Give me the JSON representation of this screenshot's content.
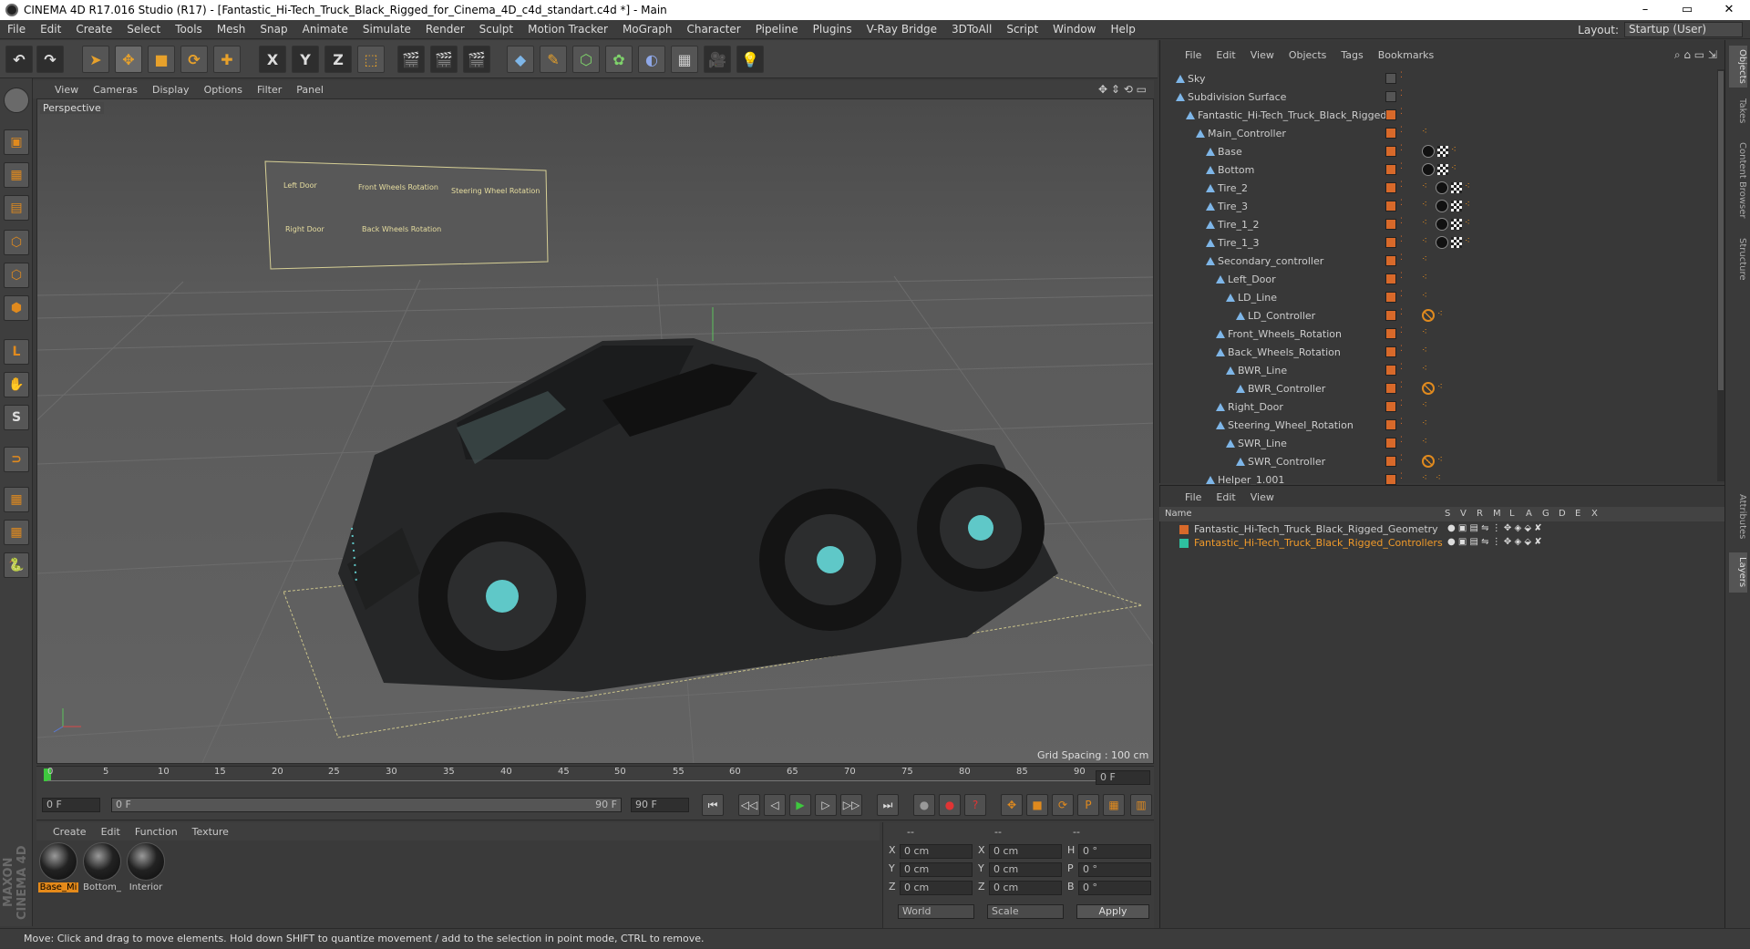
{
  "window": {
    "title": "CINEMA 4D R17.016 Studio (R17) - [Fantastic_Hi-Tech_Truck_Black_Rigged_for_Cinema_4D_c4d_standart.c4d *] - Main",
    "buttons": [
      "–",
      "▭",
      "✕"
    ]
  },
  "menu": [
    "File",
    "Edit",
    "Create",
    "Select",
    "Tools",
    "Mesh",
    "Snap",
    "Animate",
    "Simulate",
    "Render",
    "Sculpt",
    "Motion Tracker",
    "MoGraph",
    "Character",
    "Pipeline",
    "Plugins",
    "V-Ray Bridge",
    "3DToAll",
    "Script",
    "Window",
    "Help"
  ],
  "layout": {
    "label": "Layout:",
    "value": "Startup (User)"
  },
  "toolbar": [
    "↶",
    "↷",
    "➤",
    "✥",
    "■",
    "⟳",
    "✚",
    "X",
    "Y",
    "Z",
    "⬚",
    "🎬",
    "🎬",
    "🎬",
    "◆",
    "✎",
    "⬡",
    "✿",
    "◐",
    "▦",
    "🎥",
    "💡"
  ],
  "viewport": {
    "menu": [
      "View",
      "Cameras",
      "Display",
      "Options",
      "Filter",
      "Panel"
    ],
    "label": "Perspective",
    "grid_spacing": "Grid Spacing : 100 cm",
    "controls": {
      "left_door": "Left Door",
      "front_wheels": "Front Wheels Rotation",
      "steering_wheel": "Steering Wheel Rotation",
      "right_door": "Right Door",
      "back_wheels": "Back Wheels Rotation"
    }
  },
  "timeline": {
    "ticks": [
      "0",
      "5",
      "10",
      "15",
      "20",
      "25",
      "30",
      "35",
      "40",
      "45",
      "50",
      "55",
      "60",
      "65",
      "70",
      "75",
      "80",
      "85",
      "90"
    ],
    "end_field": "0 F"
  },
  "transport": {
    "start": "0 F",
    "range_start": "0 F",
    "range_end": "90 F",
    "end": "90 F",
    "buttons": [
      "⏮",
      "◁◁",
      "◁",
      "▶",
      "▷",
      "▷▷",
      "⏭"
    ],
    "rec": [
      "●",
      "●",
      "?"
    ],
    "keys": [
      "✥",
      "■",
      "⟳",
      "P",
      "▦"
    ]
  },
  "materials": {
    "menu": [
      "Create",
      "Edit",
      "Function",
      "Texture"
    ],
    "items": [
      "Base_Mi",
      "Bottom_",
      "Interior"
    ]
  },
  "coords": {
    "header": [
      "--",
      "--",
      "--"
    ],
    "rows": [
      {
        "a": "X",
        "av": "0 cm",
        "b": "X",
        "bv": "0 cm",
        "c": "H",
        "cv": "0 °"
      },
      {
        "a": "Y",
        "av": "0 cm",
        "b": "Y",
        "bv": "0 cm",
        "c": "P",
        "cv": "0 °"
      },
      {
        "a": "Z",
        "av": "0 cm",
        "b": "Z",
        "bv": "0 cm",
        "c": "B",
        "cv": "0 °"
      }
    ],
    "world": "World",
    "scale": "Scale",
    "apply": "Apply"
  },
  "status": "Move: Click and drag to move elements. Hold down SHIFT to quantize movement / add to the selection in point mode, CTRL to remove.",
  "maxon": "MAXON CINEMA 4D",
  "objects": {
    "menu": [
      "File",
      "Edit",
      "View",
      "Objects",
      "Tags",
      "Bookmarks"
    ],
    "rows": [
      {
        "name": "Sky",
        "indent": 0,
        "tags": ""
      },
      {
        "name": "Subdivision Surface",
        "indent": 0,
        "tags": ""
      },
      {
        "name": "Fantastic_Hi-Tech_Truck_Black_Rigged",
        "indent": 1,
        "tags": ""
      },
      {
        "name": "Main_Controller",
        "indent": 2,
        "tags": "u"
      },
      {
        "name": "Base",
        "indent": 3,
        "tags": "ibu"
      },
      {
        "name": "Bottom",
        "indent": 3,
        "tags": "ibu"
      },
      {
        "name": "Tire_2",
        "indent": 3,
        "tags": "uibu"
      },
      {
        "name": "Tire_3",
        "indent": 3,
        "tags": "uibu"
      },
      {
        "name": "Tire_1_2",
        "indent": 3,
        "tags": "uibu"
      },
      {
        "name": "Tire_1_3",
        "indent": 3,
        "tags": "uibu"
      },
      {
        "name": "Secondary_controller",
        "indent": 3,
        "tags": "u"
      },
      {
        "name": "Left_Door",
        "indent": 4,
        "tags": "u"
      },
      {
        "name": "LD_Line",
        "indent": 5,
        "tags": "u"
      },
      {
        "name": "LD_Controller",
        "indent": 6,
        "tags": "su"
      },
      {
        "name": "Front_Wheels_Rotation",
        "indent": 4,
        "tags": "u"
      },
      {
        "name": "Back_Wheels_Rotation",
        "indent": 4,
        "tags": "u"
      },
      {
        "name": "BWR_Line",
        "indent": 5,
        "tags": "u"
      },
      {
        "name": "BWR_Controller",
        "indent": 6,
        "tags": "su"
      },
      {
        "name": "Right_Door",
        "indent": 4,
        "tags": "u"
      },
      {
        "name": "Steering_Wheel_Rotation",
        "indent": 4,
        "tags": "u"
      },
      {
        "name": "SWR_Line",
        "indent": 5,
        "tags": "u"
      },
      {
        "name": "SWR_Controller",
        "indent": 6,
        "tags": "su"
      },
      {
        "name": "Helper_1.001",
        "indent": 3,
        "tags": "uu"
      }
    ]
  },
  "layers": {
    "menu": [
      "File",
      "Edit",
      "View"
    ],
    "columns": [
      "Name",
      "S",
      "V",
      "R",
      "M",
      "L",
      "A",
      "G",
      "D",
      "E",
      "X"
    ],
    "rows": [
      {
        "name": "Fantastic_Hi-Tech_Truck_Black_Rigged_Geometry",
        "color": "#d8692a",
        "text": "#cccccc"
      },
      {
        "name": "Fantastic_Hi-Tech_Truck_Black_Rigged_Controllers",
        "color": "#2ec0a0",
        "text": "#f09a2a"
      }
    ]
  },
  "right_tabs": [
    "Objects",
    "Takes",
    "Content Browser",
    "Structure",
    "Attributes",
    "Layers"
  ]
}
